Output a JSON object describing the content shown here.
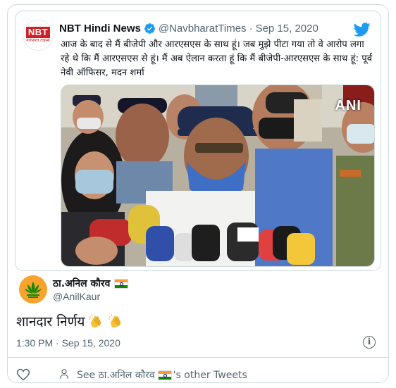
{
  "quoted_tweet": {
    "avatar_logo": "NBT",
    "avatar_subtext": "नवभारत टाइम्स",
    "name": "NBT Hindi News",
    "handle": "@NavbharatTimes",
    "separator": "·",
    "date": "Sep 15, 2020",
    "text": "आज के बाद से मैं बीजेपी और आरएसएस के साथ हूं। जब मुझे पीटा गया तो वे आरोप लगा रहे थे कि मैं आरएसएस से हूं। मैं अब ऐलान करता हूं कि मैं बीजेपी-आरएसएस के साथ हूं: पूर्व नेवी ऑफिसर, मदन शर्मा",
    "photo_watermark": "ANI"
  },
  "reply": {
    "name": "ठा.अनिल कौरव",
    "handle": "@AnilKaur",
    "text": "शानदार निर्णय",
    "timestamp": "1:30 PM · Sep 15, 2020"
  },
  "footer": {
    "see_other_prefix": "See ठा.अनिल कौरव",
    "see_other_suffix": "'s other Tweets"
  },
  "colors": {
    "twitter_blue": "#1d9bf0",
    "muted_text": "#536471",
    "border": "#cfd9de",
    "nbt_red": "#d21f26"
  },
  "icons": [
    "twitter-bird-icon",
    "verified-badge-icon",
    "info-icon",
    "heart-icon",
    "person-icon",
    "clapping-hands-icon",
    "india-flag-icon"
  ]
}
